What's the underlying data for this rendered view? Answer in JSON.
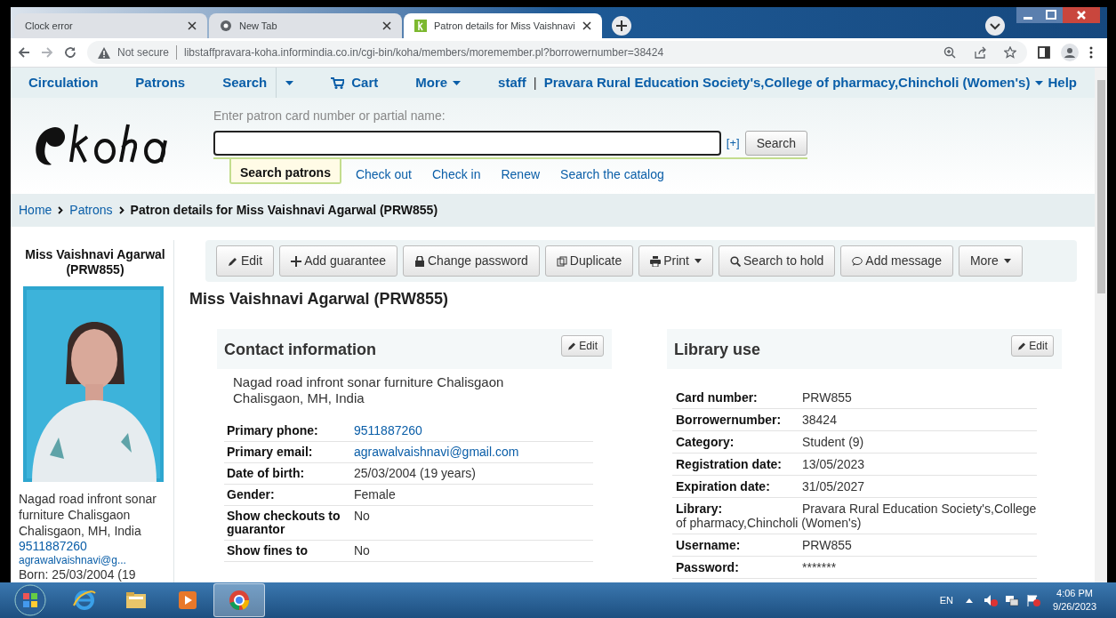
{
  "browser": {
    "tabs": [
      {
        "title": "Clock error",
        "selected": false
      },
      {
        "title": "New Tab",
        "selected": false
      },
      {
        "title": "Patron details for Miss Vaishnavi",
        "selected": true
      }
    ],
    "address": {
      "security": "Not secure",
      "url": "libstaffpravara-koha.informindia.co.in/cgi-bin/koha/members/moremember.pl?borrowernumber=38424"
    }
  },
  "nav": {
    "items": [
      "Circulation",
      "Patrons",
      "Search",
      "Cart",
      "More"
    ],
    "user": "staff",
    "separator": "|",
    "library": "Pravara Rural Education Society's,College of pharmacy,Chincholi (Women's)",
    "help": "Help"
  },
  "search": {
    "label": "Enter patron card number or partial name:",
    "expand": "[+]",
    "button": "Search",
    "tabs": [
      {
        "label": "Search patrons",
        "selected": true
      },
      {
        "label": "Check out",
        "selected": false
      },
      {
        "label": "Check in",
        "selected": false
      },
      {
        "label": "Renew",
        "selected": false
      },
      {
        "label": "Search the catalog",
        "selected": false
      }
    ]
  },
  "breadcrumb": [
    "Home",
    "Patrons",
    "Patron details for Miss Vaishnavi Agarwal (PRW855)"
  ],
  "sidebar": {
    "name": "Miss Vaishnavi Agarwal (PRW855)",
    "address": "Nagad road infront sonar furniture Chalisgaon Chalisgaon, MH, India",
    "phone": "9511887260",
    "email": "agrawalvaishnavi@g...",
    "born": "Born: 25/03/2004 (19"
  },
  "toolbar": [
    {
      "label": "Edit",
      "dropdown": false
    },
    {
      "label": "Add guarantee",
      "dropdown": false
    },
    {
      "label": "Change password",
      "dropdown": false
    },
    {
      "label": "Duplicate",
      "dropdown": false
    },
    {
      "label": "Print",
      "dropdown": true
    },
    {
      "label": "Search to hold",
      "dropdown": false
    },
    {
      "label": "Add message",
      "dropdown": false
    },
    {
      "label": "More",
      "dropdown": true
    }
  ],
  "title": "Miss Vaishnavi Agarwal (PRW855)",
  "contact": {
    "title": "Contact information",
    "edit": "Edit",
    "address": [
      "Nagad road infront sonar furniture Chalisgaon",
      "Chalisgaon, MH, India"
    ],
    "rows": [
      {
        "label": "Primary phone:",
        "value": "9511887260",
        "link": true
      },
      {
        "label": "Primary email:",
        "value": "agrawalvaishnavi@gmail.com",
        "link": true
      },
      {
        "label": "Date of birth:",
        "value": "25/03/2004 (19 years)",
        "link": false
      },
      {
        "label": "Gender:",
        "value": "Female",
        "link": false
      },
      {
        "label": "Show checkouts to guarantor",
        "value": "No",
        "link": false
      },
      {
        "label": "Show fines to",
        "value": "No",
        "link": false
      }
    ]
  },
  "library_use": {
    "title": "Library use",
    "edit": "Edit",
    "rows": [
      {
        "label": "Card number:",
        "value": "PRW855",
        "wide": false
      },
      {
        "label": "Borrowernumber:",
        "value": "38424",
        "wide": false
      },
      {
        "label": "Category:",
        "value": "Student (9)",
        "wide": false
      },
      {
        "label": "Registration date:",
        "value": "13/05/2023",
        "wide": false
      },
      {
        "label": "Expiration date:",
        "value": "31/05/2027",
        "wide": false
      },
      {
        "label": "Library:",
        "value": "Pravara Rural Education Society's,College of pharmacy,Chincholi (Women's)",
        "wide": true
      },
      {
        "label": "Username:",
        "value": "PRW855",
        "wide": false
      },
      {
        "label": "Password:",
        "value": "*******",
        "wide": false
      }
    ]
  },
  "taskbar": {
    "apps": [
      {
        "selected": false
      },
      {
        "selected": false
      },
      {
        "selected": false
      },
      {
        "selected": true
      }
    ],
    "language": "EN",
    "time": "4:06 PM",
    "date": "9/26/2023"
  }
}
